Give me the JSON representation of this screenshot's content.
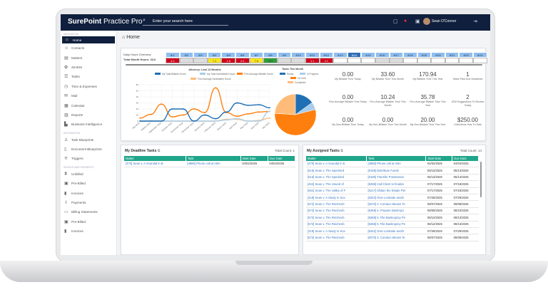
{
  "app": {
    "logo_bold": "SurePoint",
    "logo_rest": " Practice Pro",
    "search_placeholder": "Enter your search here",
    "user_name": "Sean O'Connor"
  },
  "topbar_icons": [
    "chat-icon",
    "notification-bell-icon",
    "calendar-icon",
    "logout-icon"
  ],
  "sidebar": {
    "sections": [
      {
        "label": "Navigation",
        "items": [
          {
            "label": "Home",
            "icon": "home-icon",
            "active": true
          },
          {
            "label": "Contacts",
            "icon": "contacts-icon"
          },
          {
            "label": "Matters",
            "icon": "briefcase-icon"
          },
          {
            "label": "ZenKM",
            "icon": "brain-icon"
          },
          {
            "label": "Tasks",
            "icon": "tasks-icon"
          },
          {
            "label": "Time & Expenses",
            "icon": "clock-icon"
          },
          {
            "label": "Mail",
            "icon": "mail-icon"
          },
          {
            "label": "Calendar",
            "icon": "calendar-icon"
          },
          {
            "label": "Reports",
            "icon": "reports-icon"
          },
          {
            "label": "Business Intelligence",
            "icon": "chart-icon"
          }
        ]
      },
      {
        "label": "Automation",
        "items": [
          {
            "label": "Task Blueprints",
            "icon": "blueprint-icon"
          },
          {
            "label": "Document Blueprints",
            "icon": "document-icon"
          },
          {
            "label": "Triggers",
            "icon": "triggers-icon"
          }
        ]
      },
      {
        "label": "Invoice and Payments",
        "items": [
          {
            "label": "Unbilled",
            "icon": "hourglass-icon"
          },
          {
            "label": "Pre-Billed",
            "icon": "prebilled-icon"
          },
          {
            "label": "Invoices",
            "icon": "invoice-icon"
          },
          {
            "label": "Payments",
            "icon": "payment-icon"
          },
          {
            "label": "Billing Statements",
            "icon": "statement-icon"
          },
          {
            "label": "Pre-Billed",
            "icon": "prebilled-icon"
          },
          {
            "label": "Invoices",
            "icon": "invoice-icon"
          }
        ]
      }
    ]
  },
  "page": {
    "title": "Home"
  },
  "daily_hours": {
    "title": "Daily Hours Overview",
    "total": "Total Month Hours: 33.6",
    "selected": "8/14",
    "days": [
      {
        "d": "8/1",
        "v": "4.0",
        "s": "red"
      },
      {
        "d": "8/2",
        "v": "",
        "s": "weekend"
      },
      {
        "d": "8/3",
        "v": "",
        "s": "weekend"
      },
      {
        "d": "8/4",
        "v": "7.1",
        "s": "yellow"
      },
      {
        "d": "8/5",
        "v": "1.8",
        "s": "red"
      },
      {
        "d": "8/6",
        "v": "2.0",
        "s": "red"
      },
      {
        "d": "8/7",
        "v": "7.5",
        "s": "yellow"
      },
      {
        "d": "8/8",
        "v": "8.0",
        "s": "green"
      },
      {
        "d": "8/9",
        "v": "",
        "s": "weekend"
      },
      {
        "d": "8/10",
        "v": "",
        "s": "weekend"
      },
      {
        "d": "8/11",
        "v": "1.1",
        "s": "red"
      },
      {
        "d": "8/12",
        "v": "2.1",
        "s": "red"
      },
      {
        "d": "8/13",
        "v": "",
        "s": "empty"
      },
      {
        "d": "8/14",
        "v": "",
        "s": "empty"
      },
      {
        "d": "8/15",
        "v": "",
        "s": "empty"
      },
      {
        "d": "8/16",
        "v": "",
        "s": "weekend"
      },
      {
        "d": "8/17",
        "v": "",
        "s": "weekend"
      },
      {
        "d": "8/18",
        "v": "",
        "s": "empty"
      },
      {
        "d": "8/19",
        "v": "",
        "s": "empty"
      },
      {
        "d": "8/20",
        "v": "",
        "s": "empty"
      },
      {
        "d": "8/21",
        "v": "",
        "s": "empty"
      },
      {
        "d": "8/22",
        "v": "",
        "s": "empty"
      },
      {
        "d": "8/23",
        "v": "",
        "s": "empty"
      }
    ],
    "colors": {
      "red": "#d0021b",
      "yellow": "#f8e71c",
      "green": "#2e9e3a",
      "weekend": "#dcdcdc",
      "empty": "#ffffff"
    }
  },
  "chart_data": [
    {
      "type": "line",
      "title": "Attorney: Last 13 Months",
      "categories": [
        "July 2024",
        "August 2024",
        "September 2024",
        "October 2024",
        "November 2024",
        "December 2024",
        "January 2025",
        "February 2025",
        "March 2025",
        "April 2025",
        "May 2025",
        "June 2025",
        "July 2025"
      ],
      "ylim": [
        0,
        60
      ],
      "yticks": [
        0,
        10,
        20,
        30,
        40,
        50,
        60
      ],
      "grid": true,
      "legend": "top",
      "series": [
        {
          "name": "My Total Billable Hours",
          "color": "#1f6fb4",
          "values": [
            0,
            0,
            0,
            20,
            20,
            0,
            10,
            4,
            15,
            30,
            26,
            27,
            22
          ]
        },
        {
          "name": "My Total Nonbillable Hours",
          "color": "#a7cdeb",
          "values": [
            0,
            0,
            0,
            0,
            0,
            0,
            0,
            0,
            2,
            4,
            0,
            0,
            16
          ]
        },
        {
          "name": "Firm Average Billable Hours",
          "color": "#ff7f0e",
          "values": [
            5,
            11,
            28,
            7,
            10,
            20,
            14,
            55,
            14,
            8,
            12,
            15,
            16
          ]
        },
        {
          "name": "Firm Average Nonbillable Hours",
          "color": "#ffbb78",
          "values": [
            0,
            0,
            0,
            0,
            0,
            0,
            0,
            0,
            3,
            3,
            0,
            1,
            5
          ]
        }
      ]
    },
    {
      "type": "pie",
      "title": "Tasks This Month",
      "legend": "top",
      "slices": [
        {
          "name": "Ready",
          "value": 15,
          "color": "#1f6fb4"
        },
        {
          "name": "In Progress",
          "value": 6,
          "color": "#a7cdeb"
        },
        {
          "name": "On Hold",
          "value": 55,
          "color": "#ff7f0e"
        },
        {
          "name": "Completed",
          "value": 24,
          "color": "#ffbb78"
        }
      ]
    }
  ],
  "stats": [
    {
      "n": "0.00",
      "l": "My Billable Time Today"
    },
    {
      "n": "33.60",
      "l": "My Billable Time This Month"
    },
    {
      "n": "170.94",
      "l": "My Billable Time This Year"
    },
    {
      "n": "1",
      "l": "Tasks Past Due Deadlines"
    },
    {
      "n": "0.00",
      "l": "Firm Average Billable Time Today"
    },
    {
      "n": "10.24",
      "l": "Firm Average Billable Time This Month"
    },
    {
      "n": "35.78",
      "l": "Firm Average Billable Time This Year"
    },
    {
      "n": "2",
      "l": "ATM Suggestions To Review Today"
    },
    {
      "n": "0.00",
      "l": "My Non-Billable Time Today"
    },
    {
      "n": "0.00",
      "l": "My Non-Billable Time This Month"
    },
    {
      "n": "20.00",
      "l": "My Non-Billable Time This Year"
    },
    {
      "n": "$250.00",
      "l": "Collections Year To Date"
    }
  ],
  "deadline_tasks": {
    "title": "My Deadline Tasks",
    "count": "Total Count: 1",
    "columns": [
      "Matter",
      "Task",
      "Start Date",
      "Due Date"
    ],
    "rows": [
      [
        "[470] Sean v. A Scandal in B",
        "[4885] Phone call at ABA",
        "04/02/2025",
        "04/04/2025"
      ]
    ]
  },
  "assigned_tasks": {
    "title": "My Assigned Tasks",
    "count": "Total Count: 14",
    "columns": [
      "Matter",
      "Task",
      "Start Date",
      "Due Date"
    ],
    "rows": [
      [
        "[470] Sean v. A Scandal in E",
        "[4885] Phone call at ABA",
        "04/02/2025",
        "04/04/2025"
      ],
      [
        "[515] Sean v. The Speckled",
        "[5195] Distribute Funds",
        "05/12/2025",
        "05/13/2025"
      ],
      [
        "[515] Sean v. The Speckled",
        "[5196] Transfer Possession",
        "05/13/2025",
        "05/14/2025"
      ],
      [
        "[454] Sean v. The Hound of",
        "[6298] Call Client to finalize",
        "07/17/2025",
        "07/18/2025"
      ],
      [
        "[561] Sean v. The Valley of F",
        "[6217] Obtain the Estate Pla",
        "07/17/2025",
        "07/18/2025"
      ],
      [
        "[418] Sean v. A Study in Sca",
        "[6342] Give Lestrade anoth",
        "07/28/2025",
        "07/29/2025"
      ],
      [
        "[572] Sean v. The Reichenb",
        "[6370] 3. Conduct Means Te",
        "08/07/2025",
        "08/08/2025"
      ],
      [
        "[572] Sean v. The Reichenb",
        "[6369] 4. Prepare Bankrupt",
        "08/09/2025",
        "08/10/2025"
      ],
      [
        "[572] Sean v. The Reichenb",
        "[6368] 5. File Bankruptcy Pe",
        "08/12/2025",
        "08/13/2025"
      ],
      [
        "[572] Sean v. The Reichenb",
        "[6368] 5. File Bankruptcy Pe",
        "08/12/2025",
        "08/13/2025"
      ],
      [
        "[418] Sean v. A Study in Sca",
        "[6342] Give Lestrade anoth",
        "07/28/2025",
        "07/29/2025"
      ],
      [
        "[572] Sean v. The Reichenb",
        "[6370] 3. Conduct Means Te",
        "08/07/2025",
        "08/08/2025"
      ]
    ]
  }
}
